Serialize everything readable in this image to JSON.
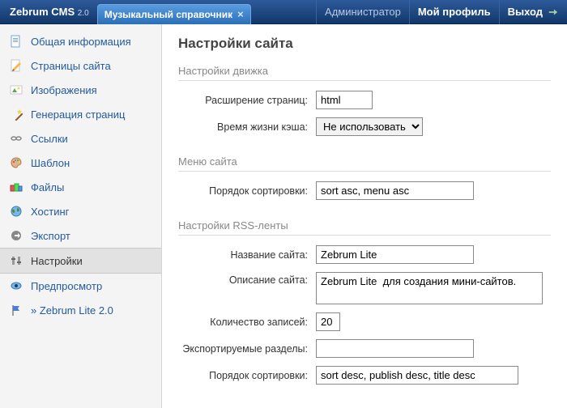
{
  "header": {
    "brand": "Zebrum CMS",
    "version": "2.0",
    "tab_label": "Музыкальный справочник",
    "admin": "Администратор",
    "profile": "Мой профиль",
    "exit": "Выход"
  },
  "sidebar": {
    "items": [
      {
        "label": "Общая информация",
        "icon": "page-info"
      },
      {
        "label": "Страницы сайта",
        "icon": "pencil-page"
      },
      {
        "label": "Изображения",
        "icon": "image"
      },
      {
        "label": "Генерация страниц",
        "icon": "wand"
      },
      {
        "label": "Ссылки",
        "icon": "link"
      },
      {
        "label": "Шаблон",
        "icon": "palette"
      },
      {
        "label": "Файлы",
        "icon": "files"
      },
      {
        "label": "Хостинг",
        "icon": "globe"
      },
      {
        "label": "Экспорт",
        "icon": "export"
      },
      {
        "label": "Настройки",
        "icon": "settings",
        "active": true
      },
      {
        "label": "Предпросмотр",
        "icon": "eye"
      },
      {
        "label": "» Zebrum Lite 2.0",
        "icon": "flag"
      }
    ]
  },
  "content": {
    "title": "Настройки сайта",
    "sections": {
      "engine": {
        "heading": "Настройки движка",
        "page_ext_label": "Расширение страниц:",
        "page_ext_value": "html",
        "cache_ttl_label": "Время жизни кэша:",
        "cache_ttl_value": "Не использовать"
      },
      "menu": {
        "heading": "Меню сайта",
        "sort_label": "Порядок сортировки:",
        "sort_value": "sort asc, menu asc"
      },
      "rss": {
        "heading": "Настройки RSS-ленты",
        "site_name_label": "Название сайта:",
        "site_name_value": "Zebrum Lite",
        "site_desc_label": "Описание сайта:",
        "site_desc_value": "Zebrum Lite  для создания мини-сайтов.",
        "count_label": "Количество записей:",
        "count_value": "20",
        "export_sections_label": "Экспортируемые разделы:",
        "export_sections_value": "",
        "sort_label": "Порядок сортировки:",
        "sort_value": "sort desc, publish desc, title desc"
      }
    }
  }
}
